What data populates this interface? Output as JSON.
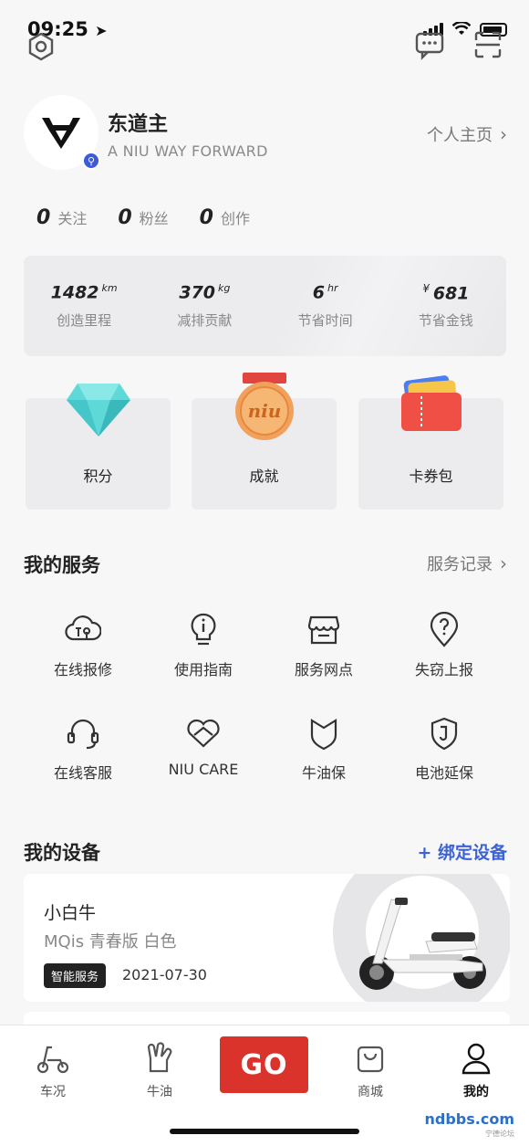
{
  "status": {
    "time": "09:25"
  },
  "profile": {
    "name": "东道主",
    "slogan": "A NIU WAY FORWARD",
    "homepage_link": "个人主页"
  },
  "follow": [
    {
      "count": "0",
      "label": "关注"
    },
    {
      "count": "0",
      "label": "粉丝"
    },
    {
      "count": "0",
      "label": "创作"
    }
  ],
  "stats": [
    {
      "value": "1482",
      "unit": "km",
      "prefix": "",
      "label": "创造里程"
    },
    {
      "value": "370",
      "unit": "kg",
      "prefix": "",
      "label": "减排贡献"
    },
    {
      "value": "6",
      "unit": "hr",
      "prefix": "",
      "label": "节省时间"
    },
    {
      "value": "681",
      "unit": "",
      "prefix": "¥",
      "label": "节省金钱"
    }
  ],
  "cards": [
    {
      "label": "积分",
      "icon": "diamond-icon"
    },
    {
      "label": "成就",
      "icon": "medal-icon",
      "medal_text": "niu"
    },
    {
      "label": "卡券包",
      "icon": "wallet-icon"
    }
  ],
  "services": {
    "title": "我的服务",
    "record_link": "服务记录",
    "items": [
      {
        "label": "在线报修",
        "icon": "cloud-repair-icon"
      },
      {
        "label": "使用指南",
        "icon": "bulb-info-icon"
      },
      {
        "label": "服务网点",
        "icon": "store-icon"
      },
      {
        "label": "失窃上报",
        "icon": "location-question-icon"
      },
      {
        "label": "在线客服",
        "icon": "headset-icon"
      },
      {
        "label": "NIU CARE",
        "icon": "heart-care-icon"
      },
      {
        "label": "牛油保",
        "icon": "shield-icon"
      },
      {
        "label": "电池延保",
        "icon": "battery-shield-icon"
      }
    ]
  },
  "devices": {
    "title": "我的设备",
    "bind_link": "+ 绑定设备",
    "items": [
      {
        "name": "小白牛",
        "model": "MQis 青春版 白色",
        "tag": "智能服务",
        "date": "2021-07-30"
      }
    ]
  },
  "tabbar": {
    "items": [
      {
        "label": "车况",
        "icon": "scooter-icon",
        "active": false
      },
      {
        "label": "牛油",
        "icon": "hand-icon",
        "active": false
      },
      {
        "label": "GO",
        "icon": "go-icon",
        "active": false
      },
      {
        "label": "商城",
        "icon": "bag-icon",
        "active": false
      },
      {
        "label": "我的",
        "icon": "person-icon",
        "active": true
      }
    ]
  },
  "watermark": {
    "text": "ndbbs.com",
    "sub": "宁德论坛"
  },
  "colors": {
    "accent_blue": "#3b63d6",
    "go_red": "#d9332b"
  }
}
